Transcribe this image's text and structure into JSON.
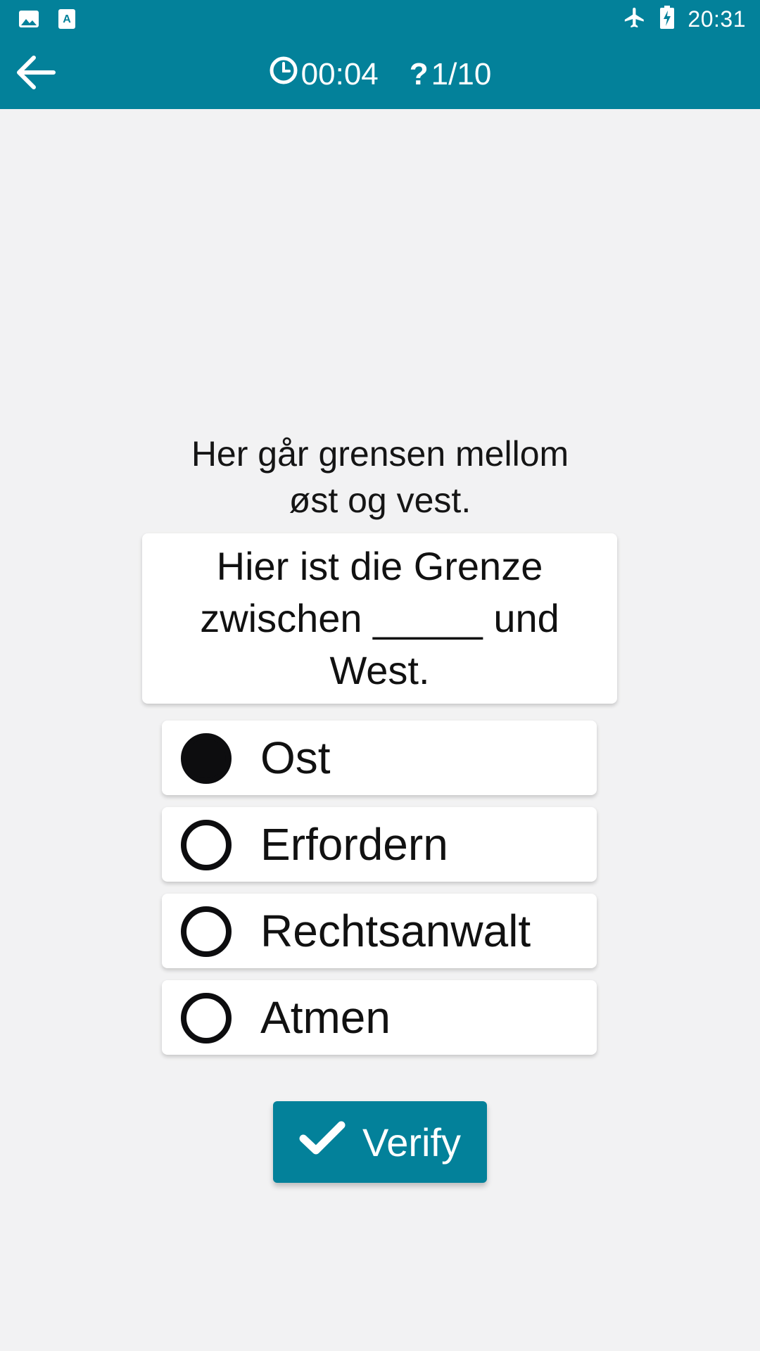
{
  "status_bar": {
    "left_icons": [
      "image-icon",
      "text-a-icon"
    ],
    "right_icons": [
      "airplane-icon",
      "battery-charging-icon"
    ],
    "time": "20:31"
  },
  "app_bar": {
    "back_icon": "arrow-left-icon",
    "timer_icon": "clock-icon",
    "timer": "00:04",
    "question_icon": "question-mark-icon",
    "progress": "1/10"
  },
  "question": {
    "prompt_lines": [
      "Her går grensen mellom",
      "øst og vest."
    ],
    "card_lines": [
      "Hier ist die Grenze",
      "zwischen _____ und",
      "West."
    ]
  },
  "options": [
    {
      "label": "Ost",
      "selected": true
    },
    {
      "label": "Erfordern",
      "selected": false
    },
    {
      "label": "Rechtsanwalt",
      "selected": false
    },
    {
      "label": "Atmen",
      "selected": false
    }
  ],
  "verify_button": {
    "label": "Verify",
    "icon": "check-icon"
  },
  "colors": {
    "accent": "#03819a",
    "background": "#f2f2f3"
  }
}
